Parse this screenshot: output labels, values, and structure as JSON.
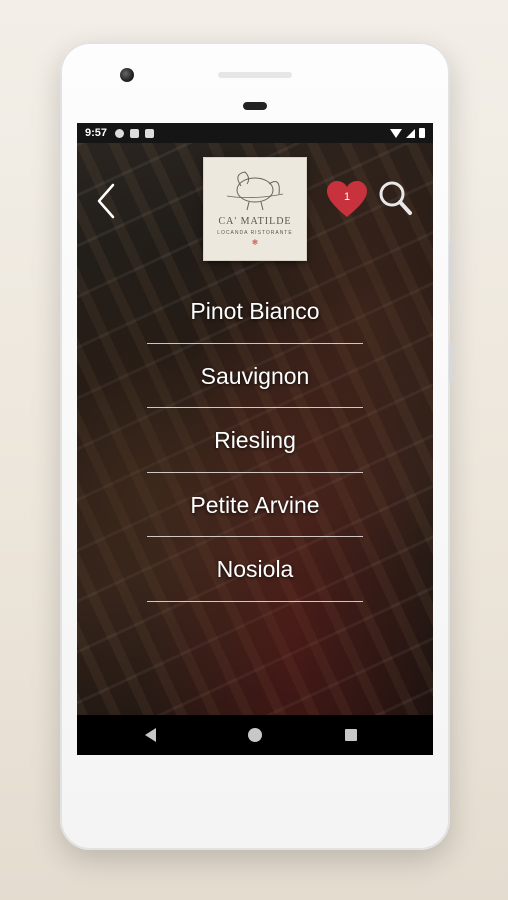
{
  "status_bar": {
    "time": "9:57",
    "left_icons": [
      "settings-icon",
      "shield-icon",
      "sd-card-icon"
    ],
    "right_icons": [
      "wifi-icon",
      "signal-icon",
      "battery-icon"
    ]
  },
  "header": {
    "back_icon": "chevron-left-icon",
    "logo": {
      "name": "CA' MATILDE",
      "subtitle": "LOCANDA RISTORANTE"
    },
    "favorites_count": "1",
    "favorites_icon": "heart-icon",
    "search_icon": "search-icon"
  },
  "wine_list": [
    "Pinot Bianco",
    "Sauvignon",
    "Riesling",
    "Petite Arvine",
    "Nosiola"
  ],
  "nav_bar": {
    "buttons": [
      "back-triangle-icon",
      "home-circle-icon",
      "recents-square-icon"
    ]
  },
  "colors": {
    "heart": "#c8323c",
    "divider": "#ffffff",
    "logo_bg": "#ece8de"
  }
}
